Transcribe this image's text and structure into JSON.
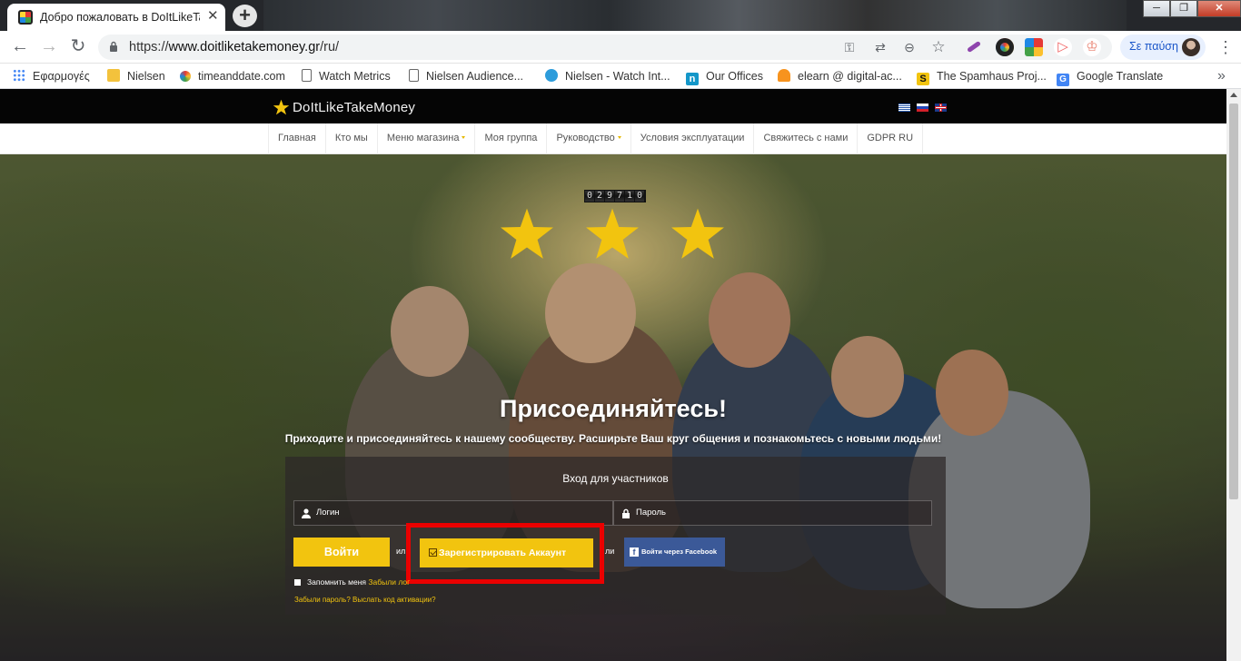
{
  "browser": {
    "tab_title": "Добро пожаловать в DoItLikeTa",
    "tab_close": "✕",
    "new_tab": "+",
    "window_minimize": "─",
    "window_maximize": "❐",
    "window_close": "✕",
    "url_prefix": "https://",
    "url_host": "www.doitliketakemoney.gr",
    "url_path": "/ru/",
    "profile_label": "Σε παύση",
    "back": "←",
    "forward": "→",
    "reload": "↻",
    "menu": "⋮",
    "omnibox_icons": [
      "key-icon",
      "translate-icon",
      "zoom-icon",
      "bookmark-star-icon"
    ],
    "extension_icons": [
      "feather-icon",
      "color-ring-icon",
      "pinwheel-icon",
      "cast-icon",
      "stamp-icon"
    ]
  },
  "bookmarks": [
    {
      "label": "Εφαρμογές",
      "icon": "apps-icon"
    },
    {
      "label": "Nielsen",
      "icon": "folder-icon"
    },
    {
      "label": "timeanddate.com",
      "icon": "timeanddate-icon"
    },
    {
      "label": "Watch Metrics",
      "icon": "page-icon"
    },
    {
      "label": "Nielsen Audience...",
      "icon": "page-icon"
    },
    {
      "label": "Nielsen - Watch Int...",
      "icon": "nielsen-icon"
    },
    {
      "label": "Our Offices",
      "icon": "offices-icon"
    },
    {
      "label": "elearn @ digital-ac...",
      "icon": "moodle-icon"
    },
    {
      "label": "The Spamhaus Proj...",
      "icon": "spamhaus-icon"
    },
    {
      "label": "Google Translate",
      "icon": "google-translate-icon"
    }
  ],
  "bookmarks_overflow": "»",
  "site": {
    "logo_text": "DoItLikeTakeMoney",
    "languages": [
      "el",
      "ru",
      "en"
    ],
    "nav": [
      {
        "label": "Главная",
        "dropdown": false
      },
      {
        "label": "Кто мы",
        "dropdown": false
      },
      {
        "label": "Меню магазина",
        "dropdown": true
      },
      {
        "label": "Моя группа",
        "dropdown": false
      },
      {
        "label": "Руководство",
        "dropdown": true
      },
      {
        "label": "Условия эксплуатации",
        "dropdown": false
      },
      {
        "label": "Свяжитесь с нами",
        "dropdown": false
      },
      {
        "label": "GDPR RU",
        "dropdown": false
      }
    ],
    "counter_digits": [
      "0",
      "2",
      "9",
      "7",
      "1",
      "0"
    ],
    "rating_stars": 3,
    "hero_title": "Присоединяйтесь!",
    "hero_subtitle": "Приходите и присоединяйтесь к нашему сообществу. Расширьте Ваш круг общения и познакомьтесь с новыми людьми!",
    "login": {
      "panel_title": "Вход для участников",
      "username_placeholder": "Логин",
      "password_placeholder": "Пароль",
      "login_button": "Войти",
      "or_1": "ил",
      "register_button": "Зарегистрировать Аккаунт",
      "or_2": "ли",
      "facebook_button": "Войти через Facebook",
      "remember_me": "Запомнить меня",
      "forgot_login_link": "Забыли лог",
      "forgot_password_link": "Забыли пароль?",
      "resend_activation_link": "Выслать код активации?"
    }
  },
  "colors": {
    "accent": "#f2c40f",
    "highlight": "#ea0000",
    "facebook": "#3b5998",
    "header_bg": "#050505"
  }
}
